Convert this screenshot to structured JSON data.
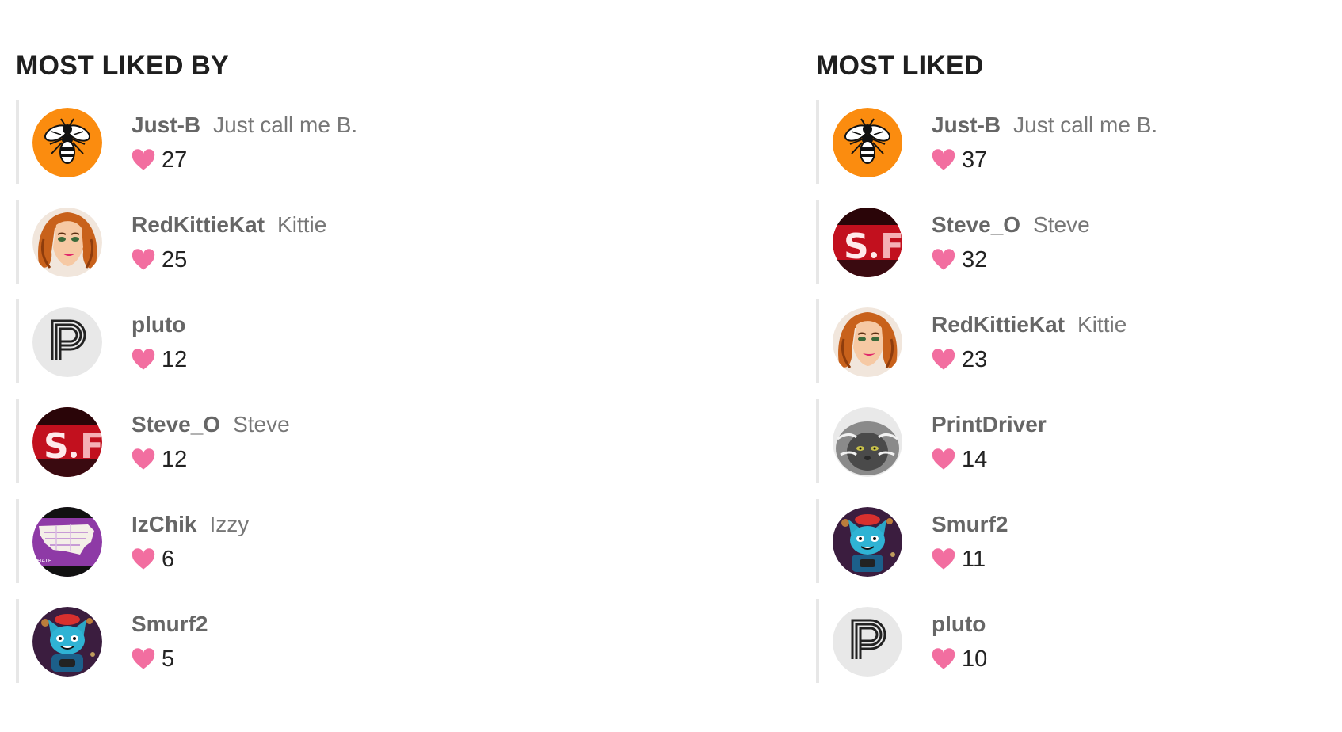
{
  "colors": {
    "heart": "#f26ea0",
    "username": "#666666",
    "display_name": "#777777",
    "border": "#e7e7e7"
  },
  "most_liked_by": {
    "title": "MOST LIKED BY",
    "items": [
      {
        "username": "Just-B",
        "display_name": "Just call me B.",
        "likes": "27",
        "avatar": "bee-avatar"
      },
      {
        "username": "RedKittieKat",
        "display_name": "Kittie",
        "likes": "25",
        "avatar": "woman-portrait-avatar"
      },
      {
        "username": "pluto",
        "display_name": "",
        "likes": "12",
        "avatar": "letter-p-avatar"
      },
      {
        "username": "Steve_O",
        "display_name": "Steve",
        "likes": "12",
        "avatar": "neon-sign-avatar"
      },
      {
        "username": "IzChik",
        "display_name": "Izzy",
        "likes": "6",
        "avatar": "map-avatar"
      },
      {
        "username": "Smurf2",
        "display_name": "",
        "likes": "5",
        "avatar": "cat-avatar"
      }
    ]
  },
  "most_liked": {
    "title": "MOST LIKED",
    "items": [
      {
        "username": "Just-B",
        "display_name": "Just call me B.",
        "likes": "37",
        "avatar": "bee-avatar"
      },
      {
        "username": "Steve_O",
        "display_name": "Steve",
        "likes": "32",
        "avatar": "neon-sign-avatar"
      },
      {
        "username": "RedKittieKat",
        "display_name": "Kittie",
        "likes": "23",
        "avatar": "woman-portrait-avatar"
      },
      {
        "username": "PrintDriver",
        "display_name": "",
        "likes": "14",
        "avatar": "fluffy-cat-avatar"
      },
      {
        "username": "Smurf2",
        "display_name": "",
        "likes": "11",
        "avatar": "cat-avatar"
      },
      {
        "username": "pluto",
        "display_name": "",
        "likes": "10",
        "avatar": "letter-p-avatar"
      }
    ]
  }
}
